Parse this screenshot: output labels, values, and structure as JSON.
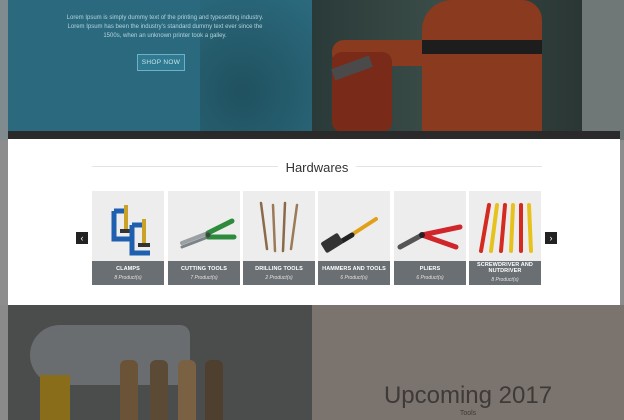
{
  "hero": {
    "text": "Lorem Ipsum is simply dummy text of the printing and typesetting industry. Lorem Ipsum has been the industry's standard dummy text ever since the 1500s, when an unknown printer took a galley.",
    "button": "SHOP NOW"
  },
  "hardwares": {
    "title": "Hardwares",
    "prev_icon": "chevron-left-icon",
    "next_icon": "chevron-right-icon",
    "categories": [
      {
        "name": "CLAMPS",
        "count": "8 Product(s)"
      },
      {
        "name": "CUTTING TOOLS",
        "count": "7 Product(s)"
      },
      {
        "name": "DRILLING TOOLS",
        "count": "2 Product(s)"
      },
      {
        "name": "HAMMERS AND TOOLS",
        "count": "6 Product(s)"
      },
      {
        "name": "PLIERS",
        "count": "6 Product(s)"
      },
      {
        "name": "SCREWDRIVER AND NUTDRIVER",
        "count": "8 Product(s)"
      }
    ]
  },
  "promo": {
    "title": "Upcoming 2017",
    "subtitle": "Tools"
  },
  "colors": {
    "caption_bg": "#6a6f73",
    "hero_teal": "#2b6a7e",
    "tile_bg": "#ededed"
  }
}
